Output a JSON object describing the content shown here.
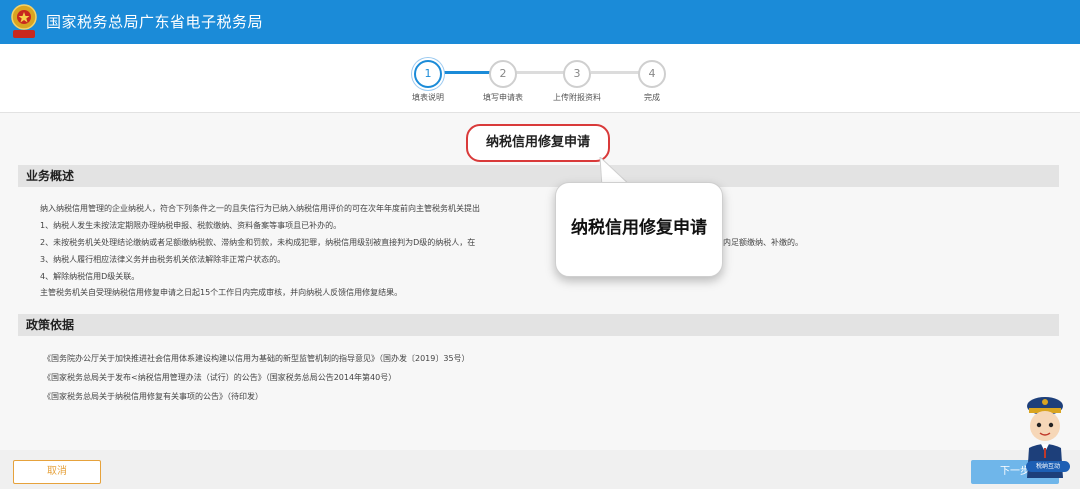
{
  "header": {
    "title": "国家税务总局广东省电子税务局",
    "logo_icon": "tax-emblem-icon",
    "bg_color": "#1b8bd8"
  },
  "steps": [
    {
      "number": "1",
      "label": "填表说明",
      "active": true
    },
    {
      "number": "2",
      "label": "填写申请表",
      "active": false
    },
    {
      "number": "3",
      "label": "上传附报资料",
      "active": false
    },
    {
      "number": "4",
      "label": "完成",
      "active": false
    }
  ],
  "form_title": "纳税信用修复申请",
  "callout_text": "纳税信用修复申请",
  "overview": {
    "heading": "业务概述",
    "lines": [
      "纳入纳税信用管理的企业纳税人，符合下列条件之一的且失信行为已纳入纳税信用评价的可在次年年度前向主管税务机关提出",
      "1、纳税人发生未按法定期限办理纳税申报、税款缴纳、资料备案等事项且已补办的。",
      "2、未按税务机关处理结论缴纳或者足额缴纳税款、滞纳金和罚款，未构成犯罪，纳税信用级别被直接判为D级的纳税人，在",
      "3、纳税人履行相应法律义务并由税务机关依法解除非正常户状态的。",
      "4、解除纳税信用D级关联。",
      "主管税务机关自受理纳税信用修复申请之日起15个工作日内完成审核，并向纳税人反馈信用修复结果。"
    ],
    "line2_tail": "内足额缴纳、补缴的。"
  },
  "policy": {
    "heading": "政策依据",
    "lines": [
      "《国务院办公厅关于加快推进社会信用体系建设构建以信用为基础的新型监管机制的指导意见》（国办发〔2019〕35号）",
      "《国家税务总局关于发布<纳税信用管理办法（试行）的公告》（国家税务总局公告2014年第40号）",
      "《国家税务总局关于纳税信用修复有关事项的公告》（待印发）"
    ]
  },
  "footer": {
    "cancel_label": "取消",
    "next_label": "下一步"
  },
  "mascot": {
    "icon": "tax-officer-mascot-icon",
    "tag": "税纳互动"
  },
  "colors": {
    "accent": "#1b8bd8",
    "highlight": "#d93a3a",
    "cancel": "#e6a23c"
  }
}
